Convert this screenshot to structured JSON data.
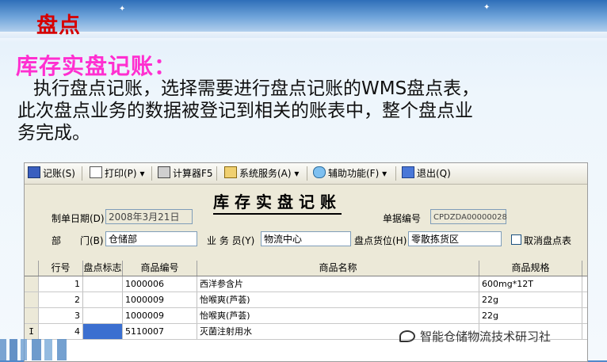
{
  "slide": {
    "title": "盘点",
    "section_title": "库存实盘记账：",
    "description_line1": "执行盘点记账，选择需要进行盘点记账的WMS盘点表，",
    "description_line2": "此次盘点业务的数据被登记到相关的账表中，整个盘点业",
    "description_line3": "务完成。"
  },
  "toolbar": {
    "post": "记账(S)",
    "print": "打印(P)",
    "calculator": "计算器F5",
    "system_service": "系统服务(A)",
    "aux_function": "辅助功能(F)",
    "exit": "退出(Q)",
    "dropdown_glyph": "▾"
  },
  "form": {
    "title": "库存实盘记账",
    "date_label": "制单日期(D)",
    "date_value": "2008年3月21日",
    "doc_no_label": "单据编号",
    "doc_no_value": "CPDZDA00000028",
    "dept_label": "部　　门(B)",
    "dept_value": "仓储部",
    "clerk_label": "业 务 员(Y)",
    "clerk_value": "物流中心",
    "location_label": "盘点货位(H)",
    "location_value": "零散拣货区",
    "cancel_label": "取消盘点表"
  },
  "grid": {
    "headers": [
      "行号",
      "盘点标志",
      "商品编号",
      "商品名称",
      "商品规格"
    ],
    "rows": [
      {
        "no": "1",
        "flag": "",
        "code": "1000006",
        "name": "西洋参含片",
        "spec": "600mg*12T"
      },
      {
        "no": "2",
        "flag": "",
        "code": "1000009",
        "name": "怡喉爽(芦荟)",
        "spec": "22g"
      },
      {
        "no": "3",
        "flag": "",
        "code": "1000009",
        "name": "怡喉爽(芦荟)",
        "spec": "22g"
      },
      {
        "no": "4",
        "flag": "",
        "code": "5110007",
        "name": "灭菌注射用水",
        "spec": ""
      }
    ],
    "cursor_glyph": "I"
  },
  "watermark": "智能仓储物流技术研习社"
}
